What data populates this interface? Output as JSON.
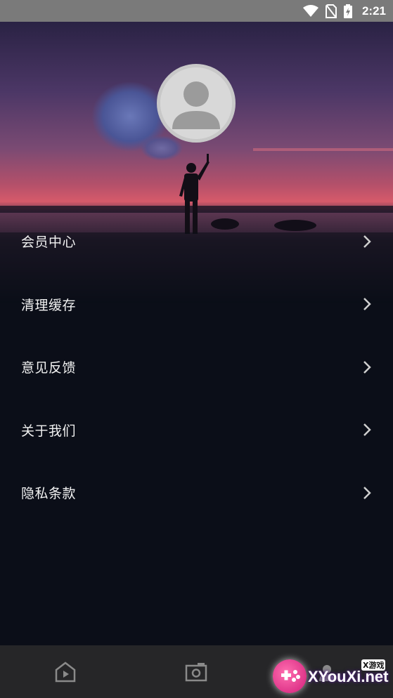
{
  "status_bar": {
    "time": "2:21",
    "icons": [
      "wifi-icon",
      "no-sim-icon",
      "battery-charging-icon"
    ]
  },
  "profile": {
    "avatar_icon": "default-user-avatar-icon"
  },
  "menu": {
    "items": [
      {
        "label": "会员中心",
        "icon": "chevron-right-icon"
      },
      {
        "label": "清理缓存",
        "icon": "chevron-right-icon"
      },
      {
        "label": "意见反馈",
        "icon": "chevron-right-icon"
      },
      {
        "label": "关于我们",
        "icon": "chevron-right-icon"
      },
      {
        "label": "隐私条款",
        "icon": "chevron-right-icon"
      }
    ]
  },
  "bottom_nav": {
    "items": [
      {
        "icon": "video-play-icon"
      },
      {
        "icon": "camera-icon"
      },
      {
        "icon": "profile-tab-icon"
      }
    ]
  },
  "watermark": {
    "text": "XYouXi.net",
    "badge": "X游戏"
  },
  "colors": {
    "background": "#0b0e18",
    "bottom_nav": "#262628",
    "status_bar": "#7a7a7a",
    "text": "#f2f2f2"
  }
}
